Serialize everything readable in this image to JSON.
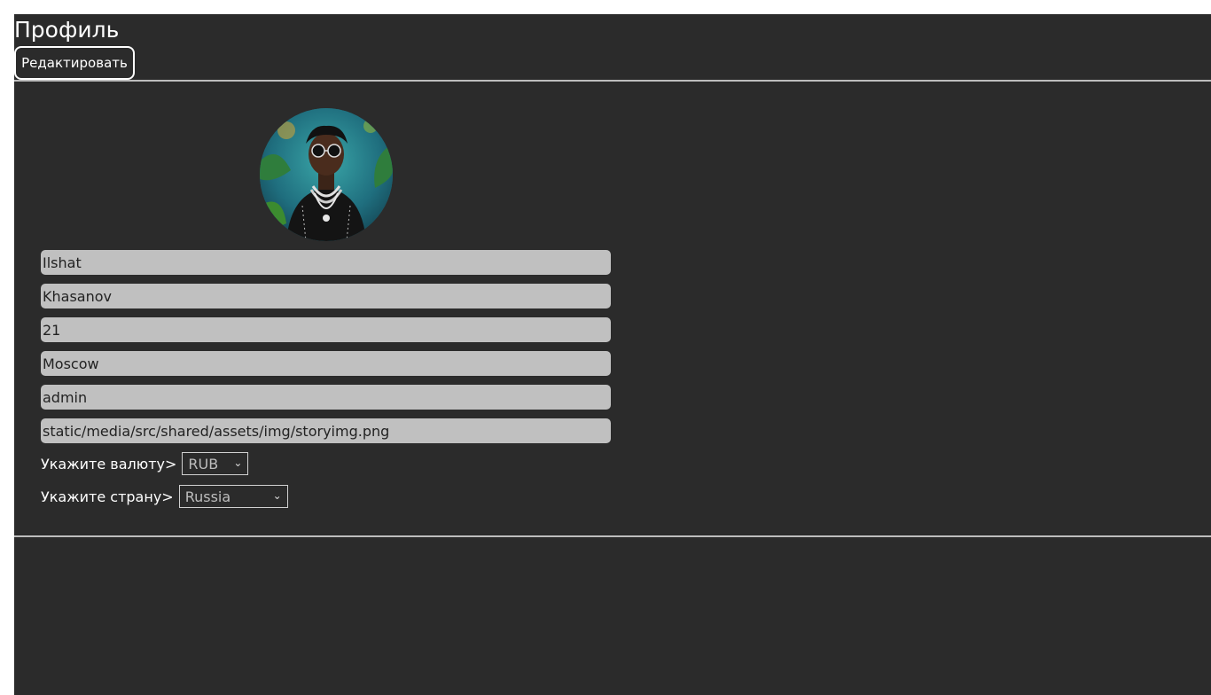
{
  "header": {
    "title": "Профиль",
    "edit_label": "Редактировать"
  },
  "profile": {
    "avatar_alt": "avatar",
    "fields": [
      {
        "name": "first-name",
        "value": "Ilshat"
      },
      {
        "name": "last-name",
        "value": "Khasanov"
      },
      {
        "name": "age",
        "value": "21"
      },
      {
        "name": "city",
        "value": "Moscow"
      },
      {
        "name": "username",
        "value": "admin"
      },
      {
        "name": "avatar-url",
        "value": "static/media/src/shared/assets/img/storyimg.png"
      }
    ],
    "currency": {
      "label": "Укажите валюту>",
      "selected": "RUB"
    },
    "country": {
      "label": "Укажите страну>",
      "selected": "Russia"
    }
  },
  "colors": {
    "background": "#2b2b2b",
    "field_bg": "#c0c0c0",
    "divider": "#bdbdbd"
  },
  "icons": {
    "dropdown": "chevron-down-icon"
  }
}
